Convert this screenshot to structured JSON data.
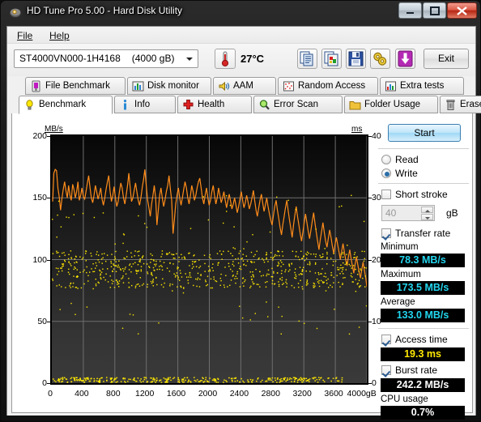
{
  "window": {
    "title": "HD Tune Pro 5.00 - Hard Disk Utility",
    "icon": "harddisk-icon",
    "minimize": "—",
    "maximize": "❐",
    "close": "✕"
  },
  "menu": {
    "file": "File",
    "help": "Help"
  },
  "toolbar": {
    "drive": "ST4000VN000-1H4168",
    "drive_capacity": "(4000 gB)",
    "temperature": "27°C",
    "buttons": [
      {
        "name": "copy-icon"
      },
      {
        "name": "copy-image-icon"
      },
      {
        "name": "save-icon"
      },
      {
        "name": "settings-icon"
      },
      {
        "name": "download-icon"
      }
    ],
    "exit_label": "Exit"
  },
  "tabs": {
    "row1": [
      {
        "label": "File Benchmark",
        "icon": "file-benchmark-icon",
        "selected": false
      },
      {
        "label": "Disk monitor",
        "icon": "disk-monitor-icon",
        "selected": false
      },
      {
        "label": "AAM",
        "icon": "speaker-icon",
        "selected": false
      },
      {
        "label": "Random Access",
        "icon": "random-access-icon",
        "selected": false
      },
      {
        "label": "Extra tests",
        "icon": "extra-tests-icon",
        "selected": false
      }
    ],
    "row2": [
      {
        "label": "Benchmark",
        "icon": "lightbulb-icon",
        "selected": true
      },
      {
        "label": "Info",
        "icon": "info-icon",
        "selected": false
      },
      {
        "label": "Health",
        "icon": "redcross-icon",
        "selected": false
      },
      {
        "label": "Error Scan",
        "icon": "magnifier-icon",
        "selected": false
      },
      {
        "label": "Folder Usage",
        "icon": "folder-icon",
        "selected": false
      },
      {
        "label": "Erase",
        "icon": "trash-icon",
        "selected": false
      }
    ]
  },
  "sidebar": {
    "start_label": "Start",
    "mode_read": "Read",
    "mode_write": "Write",
    "mode_selected": "Write",
    "short_stroke_label": "Short stroke",
    "short_stroke_checked": false,
    "short_stroke_value": "40",
    "short_stroke_unit": "gB",
    "transfer_rate_label": "Transfer rate",
    "transfer_rate_checked": true,
    "minimum_label": "Minimum",
    "minimum_value": "78.3 MB/s",
    "maximum_label": "Maximum",
    "maximum_value": "173.5 MB/s",
    "average_label": "Average",
    "average_value": "133.0 MB/s",
    "access_time_label": "Access time",
    "access_time_checked": true,
    "access_time_value": "19.3 ms",
    "burst_rate_label": "Burst rate",
    "burst_rate_checked": true,
    "burst_rate_value": "242.2 MB/s",
    "cpu_usage_label": "CPU usage",
    "cpu_usage_value": "0.7%"
  },
  "colors": {
    "transfer_curve": "#ff8c1a",
    "access_dots": "#ffe800",
    "value_cyan": "#22d6ef",
    "value_yellow": "#ffe800",
    "value_white": "#ffffff",
    "plot_bg_top": "#070707",
    "plot_bg_bottom": "#3a3a3a",
    "grid": "#6e6e6e",
    "titlebar": "#1b1b1b",
    "close_button": "#b52613"
  },
  "chart_data": {
    "type": "line",
    "title": "",
    "xlabel": "gB",
    "ylabel": "MB/s",
    "y2label": "ms",
    "ylim": [
      0,
      200
    ],
    "y2lim": [
      0,
      40
    ],
    "xlim": [
      0,
      4000
    ],
    "yticks": [
      0,
      50,
      100,
      150,
      200
    ],
    "y2ticks": [
      0,
      10,
      20,
      30,
      40
    ],
    "xticks": [
      0,
      400,
      800,
      1200,
      1600,
      2000,
      2400,
      2800,
      3200,
      3600,
      4000
    ],
    "xtick_labels": [
      "0",
      "400",
      "800",
      "1200",
      "1600",
      "2000",
      "2400",
      "2800",
      "3200",
      "3600",
      "4000gB"
    ],
    "grid": true,
    "legend": "none",
    "series": [
      {
        "name": "Transfer rate",
        "color": "#ff8c1a",
        "axis": "left",
        "unit": "MB/s",
        "x": [
          10,
          26,
          43,
          60,
          77,
          94,
          111,
          128,
          145,
          162,
          179,
          196,
          213,
          230,
          247,
          264,
          281,
          298,
          315,
          332,
          349,
          366,
          383,
          400,
          417,
          434,
          451,
          468,
          485,
          502,
          519,
          536,
          553,
          570,
          587,
          604,
          621,
          638,
          655,
          672,
          689,
          706,
          723,
          740,
          757,
          774,
          791,
          808,
          825,
          842,
          859,
          876,
          893,
          910,
          927,
          944,
          961,
          978,
          995,
          1012,
          1029,
          1046,
          1063,
          1080,
          1097,
          1114,
          1131,
          1148,
          1165,
          1182,
          1199,
          1216,
          1233,
          1250,
          1267,
          1284,
          1301,
          1318,
          1335,
          1352,
          1369,
          1386,
          1403,
          1420,
          1437,
          1454,
          1471,
          1488,
          1505,
          1522,
          1539,
          1556,
          1573,
          1590,
          1607,
          1624,
          1641,
          1658,
          1675,
          1692,
          1709,
          1726,
          1743,
          1760,
          1777,
          1794,
          1811,
          1828,
          1845,
          1862,
          1879,
          1896,
          1913,
          1930,
          1947,
          1964,
          1981,
          1998,
          2015,
          2032,
          2049,
          2066,
          2083,
          2100,
          2117,
          2134,
          2151,
          2168,
          2185,
          2202,
          2219,
          2236,
          2253,
          2270,
          2287,
          2304,
          2321,
          2338,
          2355,
          2372,
          2389,
          2406,
          2423,
          2440,
          2457,
          2474,
          2491,
          2508,
          2525,
          2542,
          2559,
          2576,
          2593,
          2610,
          2627,
          2644,
          2661,
          2678,
          2695,
          2712,
          2729,
          2746,
          2763,
          2780,
          2797,
          2814,
          2831,
          2848,
          2865,
          2882,
          2899,
          2916,
          2933,
          2950,
          2967,
          2984,
          3001,
          3018,
          3035,
          3052,
          3069,
          3086,
          3103,
          3120,
          3137,
          3154,
          3171,
          3188,
          3205,
          3222,
          3239,
          3256,
          3273,
          3290,
          3307,
          3324,
          3341,
          3358,
          3375,
          3392,
          3409,
          3426,
          3443,
          3460,
          3477,
          3494,
          3511,
          3528,
          3545,
          3562,
          3579,
          3596,
          3613,
          3630,
          3647,
          3664,
          3681,
          3698,
          3715,
          3732,
          3749,
          3766,
          3783,
          3800,
          3817,
          3834,
          3851,
          3868,
          3885,
          3902,
          3919,
          3936,
          3953,
          3970,
          3987,
          4000
        ],
        "y": [
          147,
          170,
          173,
          172,
          158,
          151,
          140,
          149,
          157,
          163,
          156,
          150,
          160,
          152,
          148,
          161,
          157,
          150,
          155,
          163,
          148,
          152,
          158,
          151,
          149,
          155,
          162,
          168,
          158,
          150,
          146,
          152,
          160,
          155,
          149,
          153,
          158,
          149,
          144,
          150,
          157,
          163,
          168,
          155,
          147,
          152,
          159,
          150,
          143,
          147,
          155,
          162,
          158,
          150,
          145,
          152,
          160,
          170,
          158,
          147,
          150,
          156,
          162,
          155,
          148,
          144,
          150,
          158,
          165,
          173,
          160,
          148,
          142,
          135,
          145,
          152,
          160,
          150,
          128,
          140,
          152,
          158,
          150,
          143,
          148,
          155,
          160,
          168,
          157,
          148,
          121,
          132,
          145,
          152,
          158,
          150,
          144,
          150,
          157,
          163,
          158,
          150,
          145,
          152,
          160,
          155,
          148,
          152,
          158,
          163,
          166,
          158,
          150,
          145,
          152,
          158,
          150,
          144,
          148,
          155,
          160,
          152,
          145,
          150,
          158,
          152,
          146,
          150,
          155,
          148,
          142,
          148,
          153,
          147,
          141,
          145,
          150,
          144,
          138,
          143,
          149,
          155,
          148,
          142,
          146,
          152,
          147,
          141,
          145,
          150,
          156,
          148,
          140,
          135,
          142,
          148,
          153,
          146,
          139,
          144,
          150,
          143,
          137,
          132,
          128,
          136,
          143,
          148,
          140,
          133,
          126,
          120,
          128,
          135,
          142,
          148,
          140,
          132,
          125,
          118,
          128,
          136,
          143,
          135,
          128,
          121,
          115,
          122,
          130,
          137,
          130,
          123,
          117,
          124,
          131,
          138,
          130,
          122,
          115,
          108,
          116,
          123,
          130,
          122,
          115,
          110,
          117,
          124,
          118,
          111,
          105,
          112,
          118,
          112,
          106,
          100,
          107,
          113,
          106,
          100,
          95,
          102,
          108,
          101,
          95,
          89,
          96,
          102,
          96,
          90,
          85,
          92,
          98,
          91,
          85,
          78
        ]
      },
      {
        "name": "Access time",
        "color": "#ffe800",
        "axis": "right",
        "unit": "ms",
        "description": "Scattered yellow dots, mostly clustered between 17 and 20 ms, with a dense band of near-zero values along the bottom axis and occasional outliers up to 30 ms.",
        "cluster_center_ms": 19.3,
        "cluster_range_ms": [
          15.5,
          21.5
        ],
        "outlier_max_ms": 30.5,
        "baseline_band_ms": [
          0.2,
          1.0
        ]
      }
    ]
  }
}
